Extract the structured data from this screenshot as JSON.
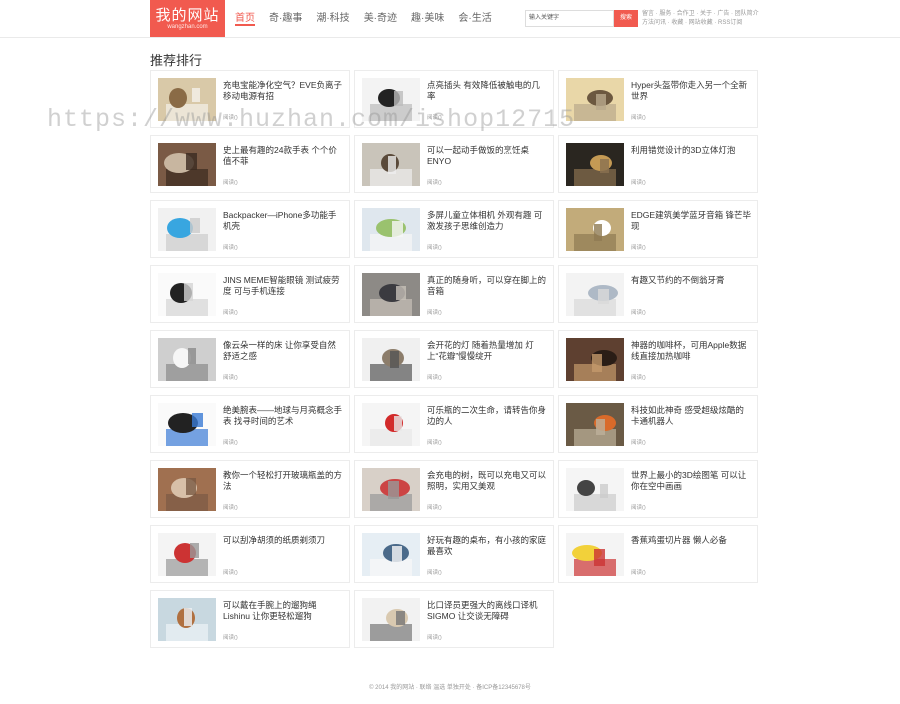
{
  "site": {
    "logo_title": "我的网站",
    "logo_sub": "wangzhan.com"
  },
  "nav": [
    "首页",
    "奇·趣事",
    "潮·科技",
    "美·奇迹",
    "趣·美味",
    "会·生活"
  ],
  "search": {
    "placeholder": "输入关键字",
    "button": "搜索"
  },
  "toplinks": [
    "留言 · 服务 · 合作卫 · 关于 · 广告 · 团队简介",
    "方法问讯 · 收藏 · 网站收藏 · RSS订阅"
  ],
  "section_title": "推荐排行",
  "read_label": "阅读()",
  "cards": [
    {
      "title": "充电宝能净化空气？EVE负离子移动电源有招",
      "icon": "air-purifier-thumbnail"
    },
    {
      "title": "点亮插头 有效降低被触电的几率",
      "icon": "plug-thumbnail"
    },
    {
      "title": "Hyper头盔带你走入另一个全新世界",
      "icon": "vr-helmet-thumbnail"
    },
    {
      "title": "史上最有趣的24款手表 个个价值不菲",
      "icon": "watch-thumbnail"
    },
    {
      "title": "可以一起动手做饭的烹饪桌ENYO",
      "icon": "cooking-table-thumbnail"
    },
    {
      "title": "利用错觉设计的3D立体灯泡",
      "icon": "bulb-thumbnail"
    },
    {
      "title": "Backpacker—iPhone多功能手机壳",
      "icon": "phone-case-thumbnail"
    },
    {
      "title": "多屏儿童立体相机 外观有趣 可激发孩子思维创造力",
      "icon": "kids-camera-thumbnail"
    },
    {
      "title": "EDGE建筑美学蓝牙音箱 锋芒毕现",
      "icon": "speaker-thumbnail"
    },
    {
      "title": "JINS MEME智能眼镜 测试疲劳度 可与手机连接",
      "icon": "glasses-thumbnail"
    },
    {
      "title": "真正的随身听，可以穿在脚上的音箱",
      "icon": "shoes-thumbnail"
    },
    {
      "title": "有趣又节约的不倒翁牙膏",
      "icon": "toothpaste-thumbnail"
    },
    {
      "title": "像云朵一样的床 让你享受自然舒适之感",
      "icon": "cloud-bed-thumbnail"
    },
    {
      "title": "会开花的灯 随着热量增加 灯上“花瓣”慢慢绽开",
      "icon": "flower-lamp-thumbnail"
    },
    {
      "title": "神器的咖啡杯，可用Apple数据线直接加热咖啡",
      "icon": "coffee-cup-thumbnail"
    },
    {
      "title": "绝美腕表——地球与月亮概念手表 找寻时间的艺术",
      "icon": "wristwatch-thumbnail"
    },
    {
      "title": "可乐瓶的二次生命，请转告你身边的人",
      "icon": "cola-bottle-thumbnail"
    },
    {
      "title": "科技如此神奇 感受超级炫酷的卡通机器人",
      "icon": "robot-thumbnail"
    },
    {
      "title": "教你一个轻松打开玻璃瓶盖的方法",
      "icon": "jar-opener-thumbnail"
    },
    {
      "title": "会充电的树，既可以充电又可以照明，实用又美观",
      "icon": "charging-tree-thumbnail"
    },
    {
      "title": "世界上最小的3D绘图笔 可以让你在空中画画",
      "icon": "3d-pen-thumbnail"
    },
    {
      "title": "可以刮净胡须的纸质剃须刀",
      "icon": "paper-razor-thumbnail"
    },
    {
      "title": "好玩有趣的桌布，有小孩的家庭最喜欢",
      "icon": "tablecloth-thumbnail"
    },
    {
      "title": "香蕉鸡蛋切片器 懒人必备",
      "icon": "egg-slicer-thumbnail"
    },
    {
      "title": "可以戴在手腕上的遛狗绳 Lishinu 让你更轻松遛狗",
      "icon": "dog-leash-thumbnail"
    },
    {
      "title": "比口译员更强大的离线口译机 SIGMO 让交谈无障碍",
      "icon": "translator-thumbnail"
    }
  ],
  "watermark": "https://www.huzhan.com/ishop12715",
  "footer": "© 2014 我的网站 · 联络 温选 单独开处 · 备ICP备12345678号"
}
